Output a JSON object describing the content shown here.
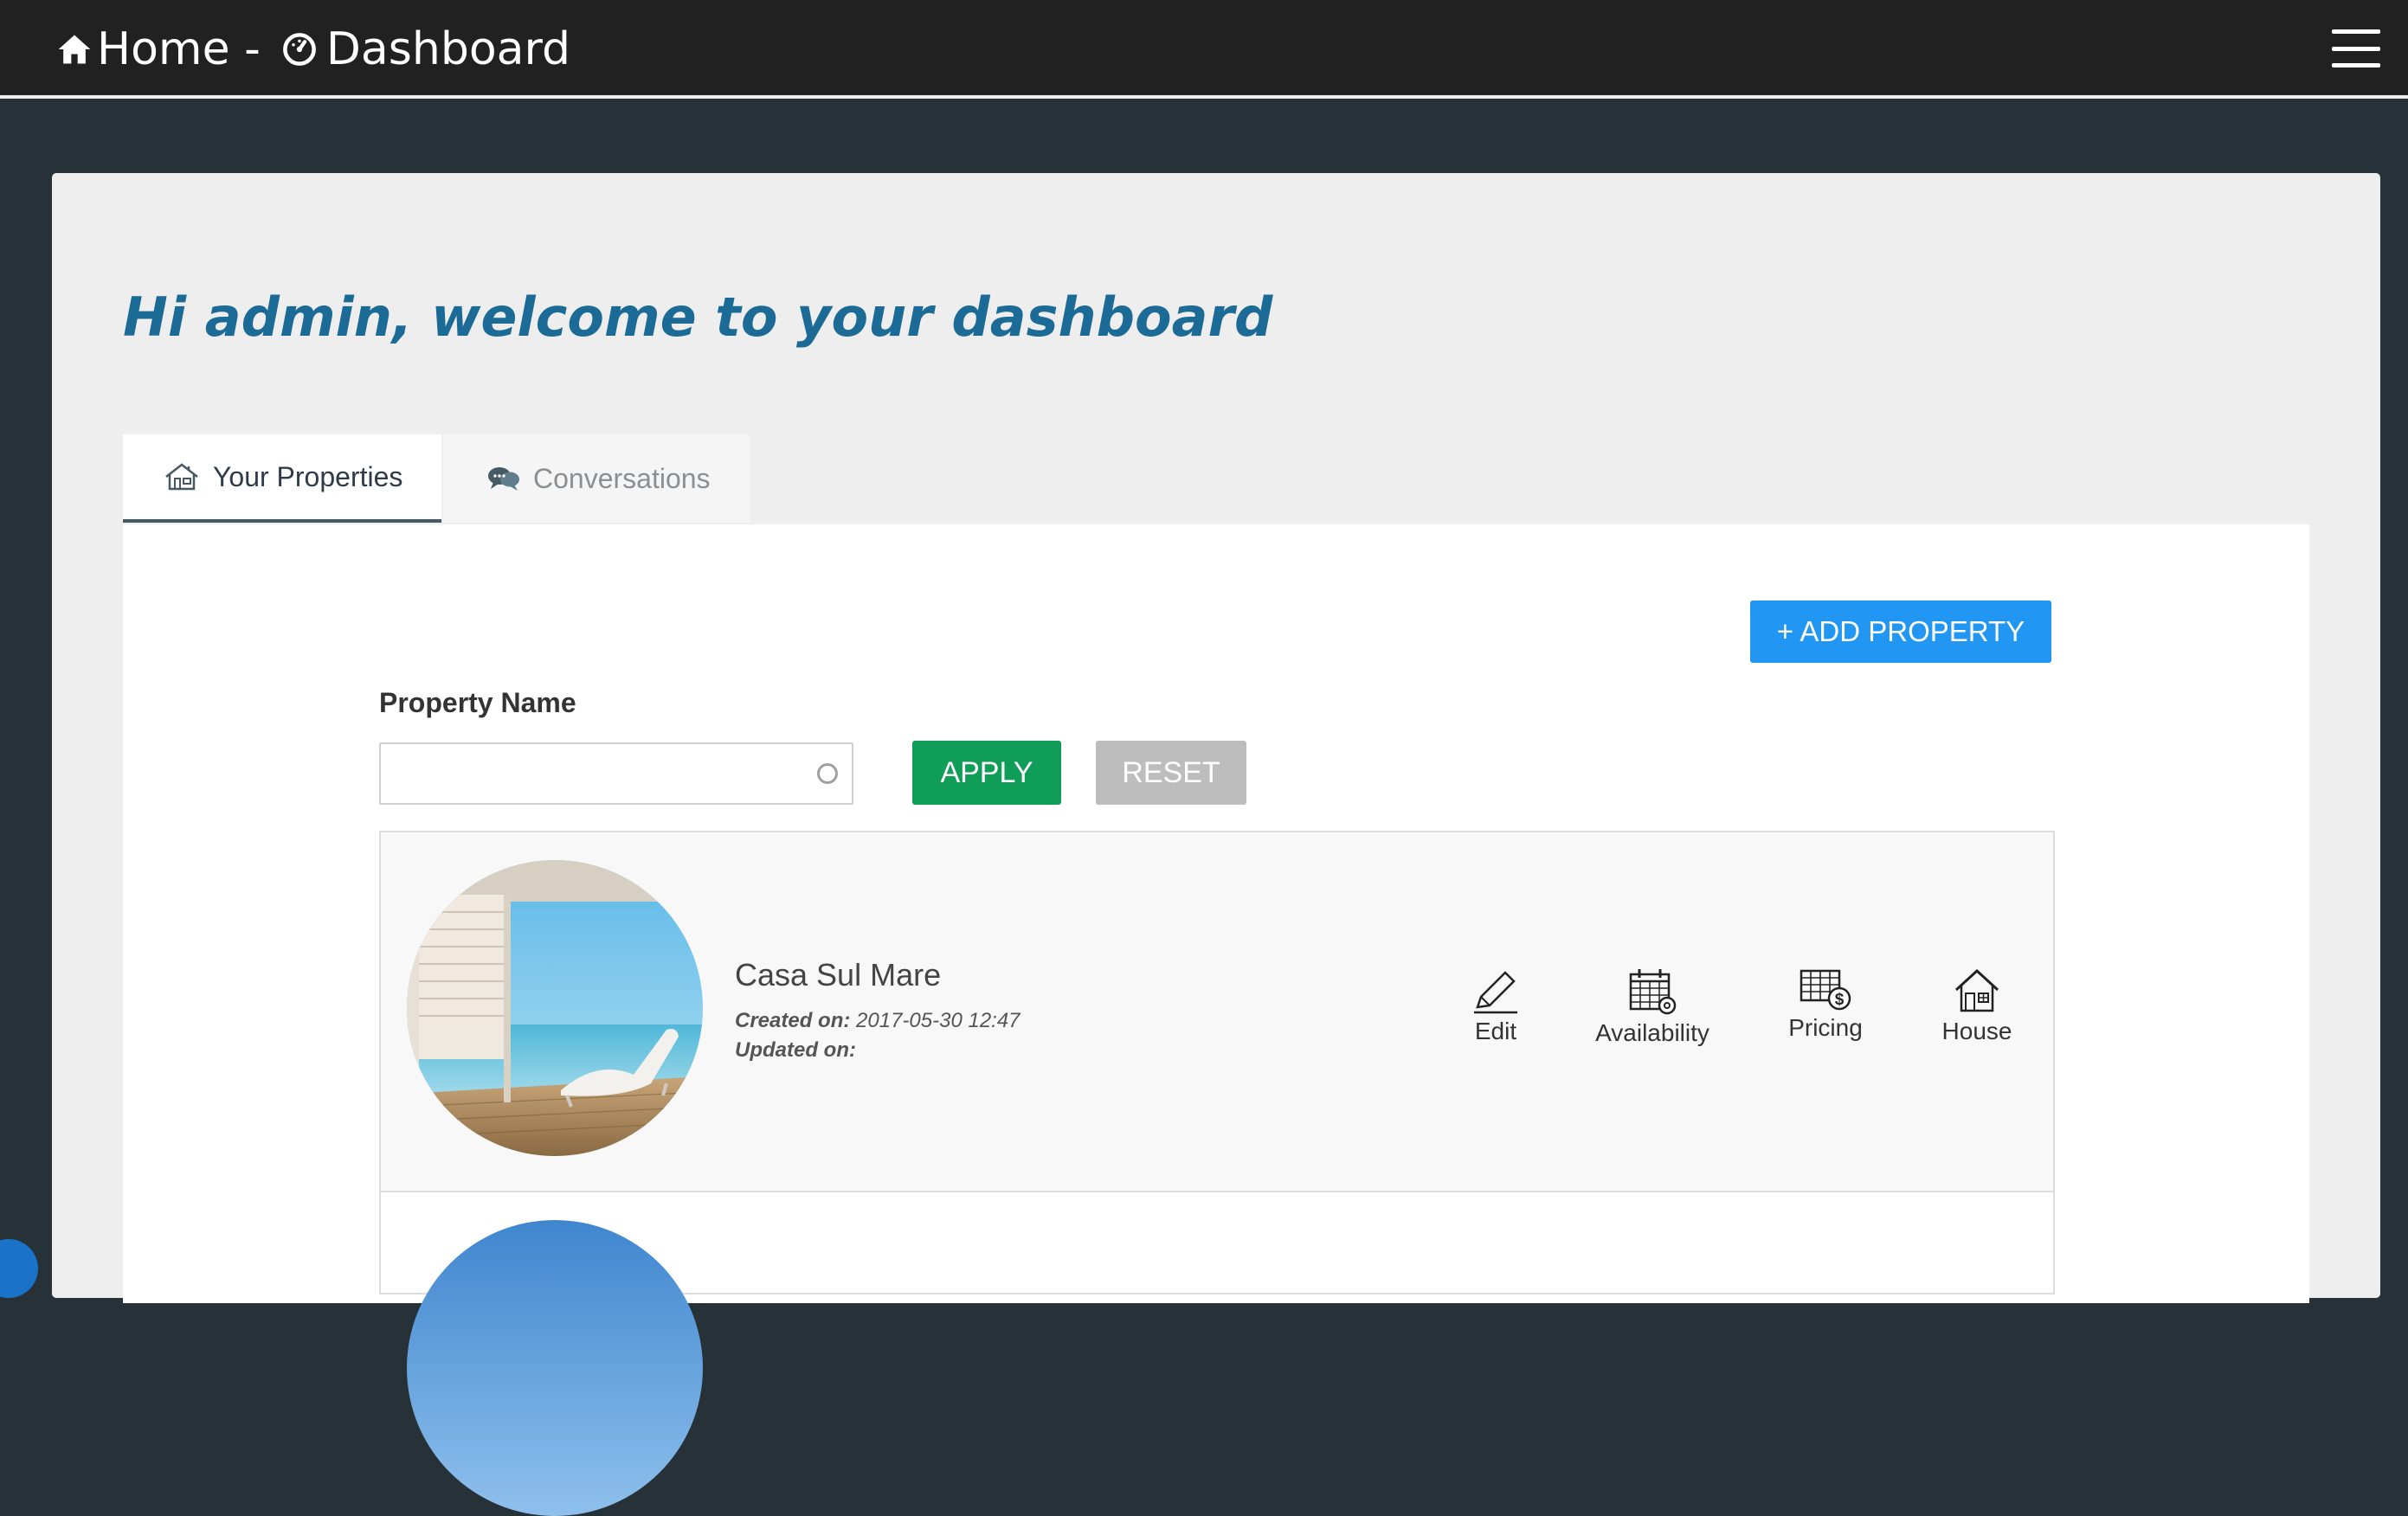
{
  "header": {
    "home_label": "Home -",
    "page_label": "Dashboard"
  },
  "welcome": "Hi admin, welcome to your dashboard",
  "tabs": [
    {
      "label": "Your Properties",
      "icon": "house-icon",
      "active": true
    },
    {
      "label": "Conversations",
      "icon": "chat-icon",
      "active": false
    }
  ],
  "toolbar": {
    "add_property_label": "+ ADD PROPERTY"
  },
  "filter": {
    "label": "Property Name",
    "value": "",
    "placeholder": "",
    "apply_label": "APPLY",
    "reset_label": "RESET"
  },
  "properties": [
    {
      "name": "Casa Sul Mare",
      "created_label": "Created on:",
      "created_value": "2017-05-30 12:47",
      "updated_label": "Updated on:",
      "updated_value": "",
      "actions": [
        {
          "label": "Edit",
          "icon": "pencil-icon"
        },
        {
          "label": "Availability",
          "icon": "calendar-gear-icon"
        },
        {
          "label": "Pricing",
          "icon": "price-grid-icon"
        },
        {
          "label": "House",
          "icon": "house-icon"
        }
      ]
    }
  ],
  "colors": {
    "topbar": "#212121",
    "page_bg": "#263238",
    "welcome": "#1b6b96",
    "add_button": "#2196f3",
    "apply_button": "#0f9d58",
    "reset_button": "#bdbdbd"
  }
}
